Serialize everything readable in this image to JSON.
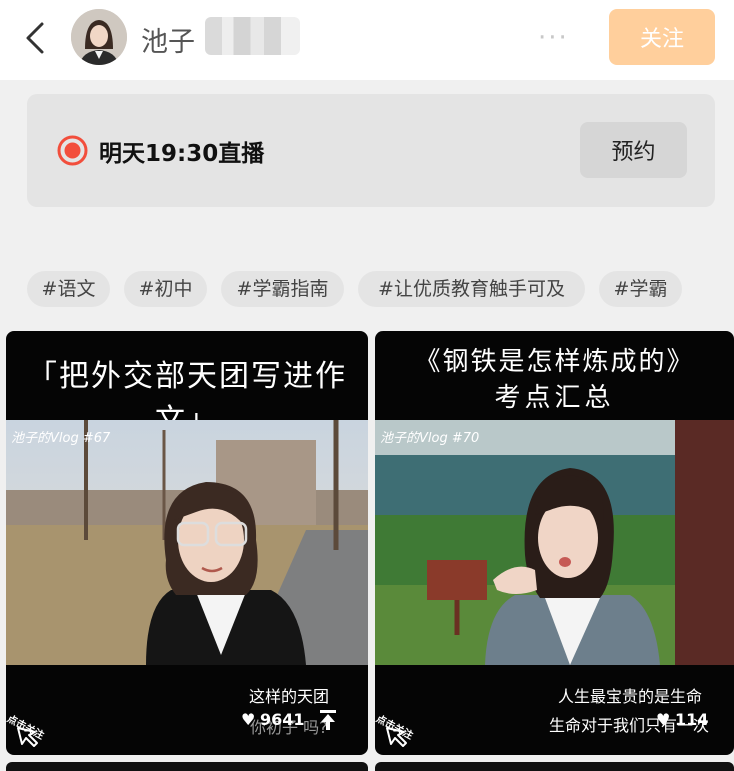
{
  "header": {
    "name": "池子",
    "more": "···",
    "follow_label": "关注"
  },
  "live": {
    "text": "明天19:30直播",
    "reserve_label": "预约"
  },
  "tags": [
    "#语文",
    "#初中",
    "#学霸指南",
    "#让优质教育触手可及",
    "#学霸"
  ],
  "videos": [
    {
      "title": "「把外交部天团写进作文」",
      "vlog": "池子的Vlog #67",
      "sub1": "这样的天团",
      "sub2": "你初子 吗?",
      "likes": "9641",
      "follow_hint": "点击关注"
    },
    {
      "title_line1": "《钢铁是怎样炼成的》",
      "title_line2": "考点汇总",
      "vlog": "池子的Vlog #70",
      "sub1": "人生最宝贵的是生命",
      "sub2": "生命对于我们只有一次",
      "likes": "114",
      "follow_hint": "点击关注"
    }
  ],
  "colors": {
    "follow_button": "#ffcf9c",
    "live_icon": "#f24e3c",
    "background": "#f0f0f0"
  },
  "icons": [
    "back-arrow-icon",
    "live-record-icon",
    "heart-icon",
    "share-icon",
    "tap-hand-icon"
  ]
}
